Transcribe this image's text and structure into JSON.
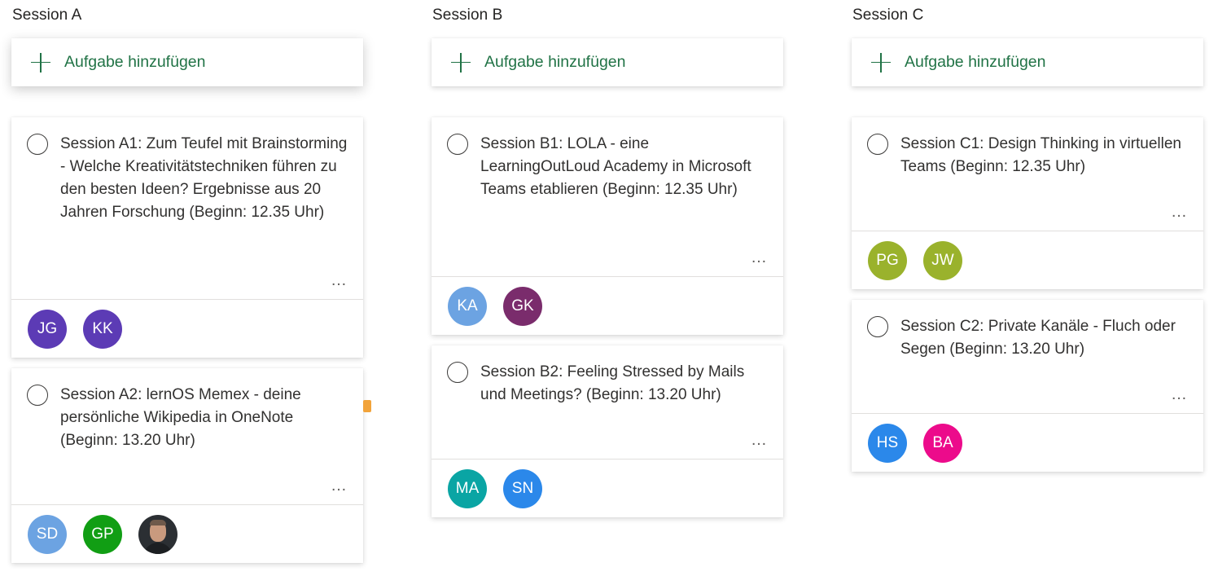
{
  "colors": {
    "accent_green": "#217346",
    "marker_orange": "#f2a33a"
  },
  "buckets": [
    {
      "title": "Session A",
      "add_label": "Aufgabe hinzufügen",
      "add_icon": "plus-icon",
      "cards": [
        {
          "title": "Session A1: Zum Teufel mit Brainstorming - Welche Kreativitätstechniken führen zu den besten Ideen? Ergebnisse aus 20 Jahren Forschung (Beginn: 12.35 Uhr)",
          "more": "…",
          "assignees": [
            {
              "initials": "JG",
              "color": "#5c3bb5"
            },
            {
              "initials": "KK",
              "color": "#5c3bb5"
            }
          ]
        },
        {
          "title": "Session A2: lernOS Memex - deine persönliche Wikipedia in OneNote (Beginn: 13.20 Uhr)",
          "more": "…",
          "assignees": [
            {
              "initials": "SD",
              "color": "#6ca3e2"
            },
            {
              "initials": "GP",
              "color": "#119e14"
            },
            {
              "initials": "",
              "color": "#2b2f33",
              "photo": true
            }
          ]
        }
      ]
    },
    {
      "title": "Session B",
      "add_label": "Aufgabe hinzufügen",
      "add_icon": "plus-icon",
      "cards": [
        {
          "title": "Session B1: LOLA - eine LearningOutLoud Academy in Microsoft Teams etablieren (Beginn: 12.35 Uhr)",
          "more": "…",
          "assignees": [
            {
              "initials": "KA",
              "color": "#6ca3e2"
            },
            {
              "initials": "GK",
              "color": "#7a2c6c"
            }
          ]
        },
        {
          "title": "Session B2: Feeling Stressed by Mails und Meetings? (Beginn: 13.20 Uhr)",
          "more": "…",
          "assignees": [
            {
              "initials": "MA",
              "color": "#0aa5a4"
            },
            {
              "initials": "SN",
              "color": "#2b88ea"
            }
          ]
        }
      ]
    },
    {
      "title": "Session C",
      "add_label": "Aufgabe hinzufügen",
      "add_icon": "plus-icon",
      "cards": [
        {
          "title": "Session C1: Design Thinking in virtuellen Teams (Beginn: 12.35 Uhr)",
          "more": "…",
          "assignees": [
            {
              "initials": "PG",
              "color": "#9ab22c"
            },
            {
              "initials": "JW",
              "color": "#9ab22c"
            }
          ]
        },
        {
          "title": "Session C2: Private Kanäle - Fluch oder Segen (Beginn: 13.20 Uhr)",
          "more": "…",
          "assignees": [
            {
              "initials": "HS",
              "color": "#2b88ea"
            },
            {
              "initials": "BA",
              "color": "#ec0b8b"
            }
          ]
        }
      ]
    }
  ]
}
